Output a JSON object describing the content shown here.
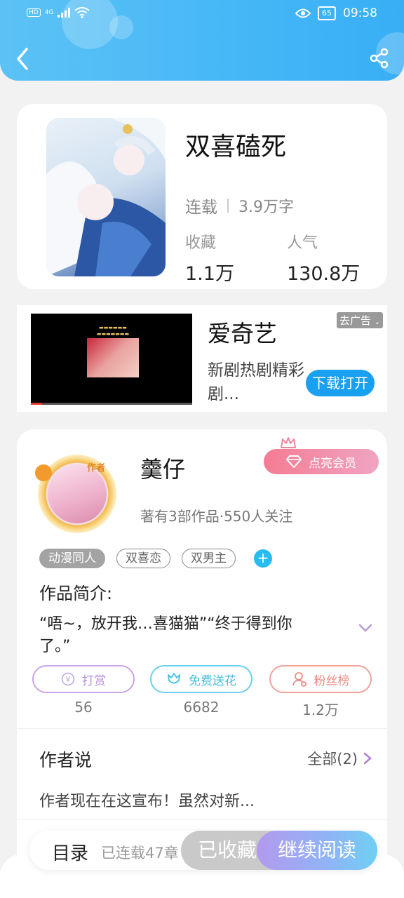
{
  "status_bar": {
    "left_tag": "HD",
    "network": "4G",
    "time": "09:58",
    "battery": "65"
  },
  "book": {
    "title": "双喜磕死",
    "status": "连载",
    "words": "3.9万字",
    "stats": [
      {
        "label": "收藏",
        "value": "1.1万"
      },
      {
        "label": "人气",
        "value": "130.8万"
      }
    ]
  },
  "ad": {
    "title": "爱奇艺",
    "description": "新剧热剧精彩剧...",
    "remove_label": "去广告",
    "download_label": "下载打开"
  },
  "author": {
    "badge": "作者",
    "name": "羹仔",
    "vip_label": "点亮会员",
    "meta": "著有3部作品·550人关注",
    "tags": [
      {
        "label": "动漫同人",
        "style": "filled"
      },
      {
        "label": "双喜恋",
        "style": "outline"
      },
      {
        "label": "双男主",
        "style": "outline"
      }
    ],
    "tag_add": "+",
    "intro_title": "作品简介:",
    "intro_text": "“唔~，放开我…喜猫猫”“终于得到你了。”",
    "actions": [
      {
        "label": "打赏",
        "count": "56",
        "icon": "yen-coin-icon"
      },
      {
        "label": "免费送花",
        "count": "6682",
        "icon": "flower-icon"
      },
      {
        "label": "粉丝榜",
        "count": "1.2万",
        "icon": "fan-ranking-icon"
      }
    ],
    "says_title": "作者说",
    "says_all": "全部(2)",
    "says_text": "作者现在在这宣布！虽然对新..."
  },
  "bottom_bar": {
    "toc_label": "目录",
    "toc_info": "已连载47章",
    "collected_label": "已收藏",
    "read_label": "继续阅读"
  },
  "colors": {
    "header": "#45b7f6",
    "vip": "#f47c93",
    "reward": "#b58ddd",
    "flower": "#43bde0",
    "fans": "#ea8a83",
    "accent_blue": "#28bcf0"
  }
}
